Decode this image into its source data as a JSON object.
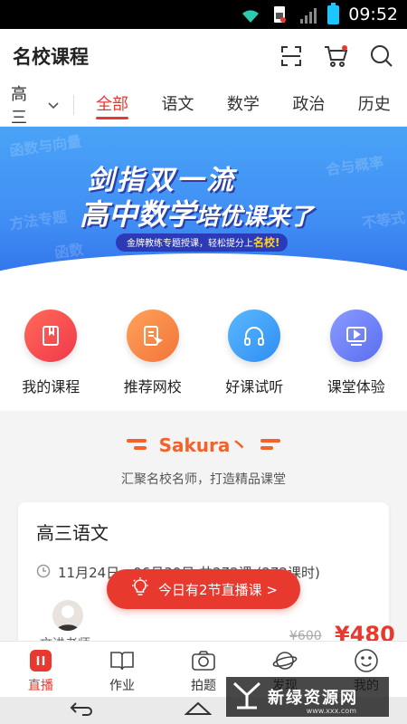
{
  "status_bar": {
    "time": "09:52"
  },
  "header": {
    "title": "名校课程"
  },
  "tabs": {
    "grade": "高三",
    "items": [
      {
        "label": "全部",
        "active": true
      },
      {
        "label": "语文",
        "active": false
      },
      {
        "label": "数学",
        "active": false
      },
      {
        "label": "政治",
        "active": false
      },
      {
        "label": "历史",
        "active": false
      }
    ]
  },
  "banner": {
    "line1": "剑指双一流",
    "line2_main": "高中数学",
    "line2_tail": "培优课来了",
    "strip_text": "金牌教练专题授课，轻松提分上",
    "strip_highlight": "名校!",
    "ghost_texts": [
      "函数与向量",
      "方法专题",
      "函数",
      "不等式",
      "合与概率"
    ]
  },
  "quick_entries": [
    {
      "label": "我的课程",
      "color": "#f2484a"
    },
    {
      "label": "推荐网校",
      "color": "#f58a4a"
    },
    {
      "label": "好课试听",
      "color": "#3fa0f5"
    },
    {
      "label": "课堂体验",
      "color": "#6b7ff2"
    }
  ],
  "section": {
    "title": "Sakura丶",
    "subtitle": "汇聚名校名师，打造精品课堂"
  },
  "course_card": {
    "title": "高三语文",
    "schedule": "11月24日 - 06月30日 共272课 (272课时)",
    "teacher": "文进老师",
    "original_price": "¥600",
    "price": "¥480"
  },
  "live_pill": {
    "label": "今日有2节直播课 >"
  },
  "bottom_nav": [
    {
      "label": "直播",
      "active": true
    },
    {
      "label": "作业",
      "active": false
    },
    {
      "label": "拍题",
      "active": false
    },
    {
      "label": "发现",
      "active": false
    },
    {
      "label": "我的",
      "active": false
    }
  ],
  "watermark": {
    "text": "新绿资源网",
    "sub": "www.xxx.com"
  },
  "colors": {
    "accent": "#e8392f",
    "section_orange": "#f2622a",
    "banner_blue": "#3f8df4"
  }
}
